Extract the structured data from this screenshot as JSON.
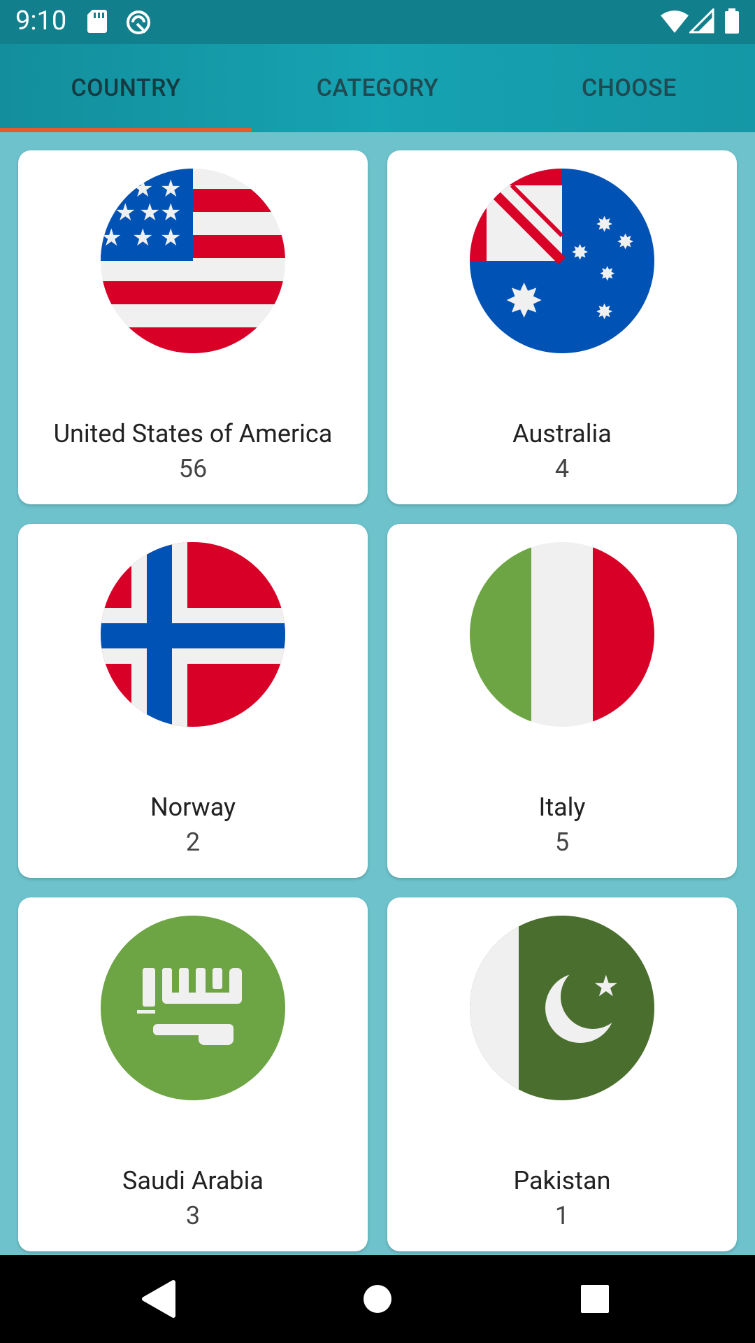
{
  "status": {
    "time": "9:10"
  },
  "tabs": [
    {
      "label": "COUNTRY",
      "active": true
    },
    {
      "label": "CATEGORY",
      "active": false
    },
    {
      "label": "CHOOSE",
      "active": false
    }
  ],
  "colors": {
    "accent": "#e65a2c",
    "toolbar": "#16a3b2",
    "background": "#6dc2cb"
  },
  "countries": [
    {
      "name": "United States of America",
      "count": "56",
      "flag": "usa-flag-icon"
    },
    {
      "name": "Australia",
      "count": "4",
      "flag": "australia-flag-icon"
    },
    {
      "name": "Norway",
      "count": "2",
      "flag": "norway-flag-icon"
    },
    {
      "name": "Italy",
      "count": "5",
      "flag": "italy-flag-icon"
    },
    {
      "name": "Saudi Arabia",
      "count": "3",
      "flag": "saudi-arabia-flag-icon"
    },
    {
      "name": "Pakistan",
      "count": "1",
      "flag": "pakistan-flag-icon"
    }
  ]
}
